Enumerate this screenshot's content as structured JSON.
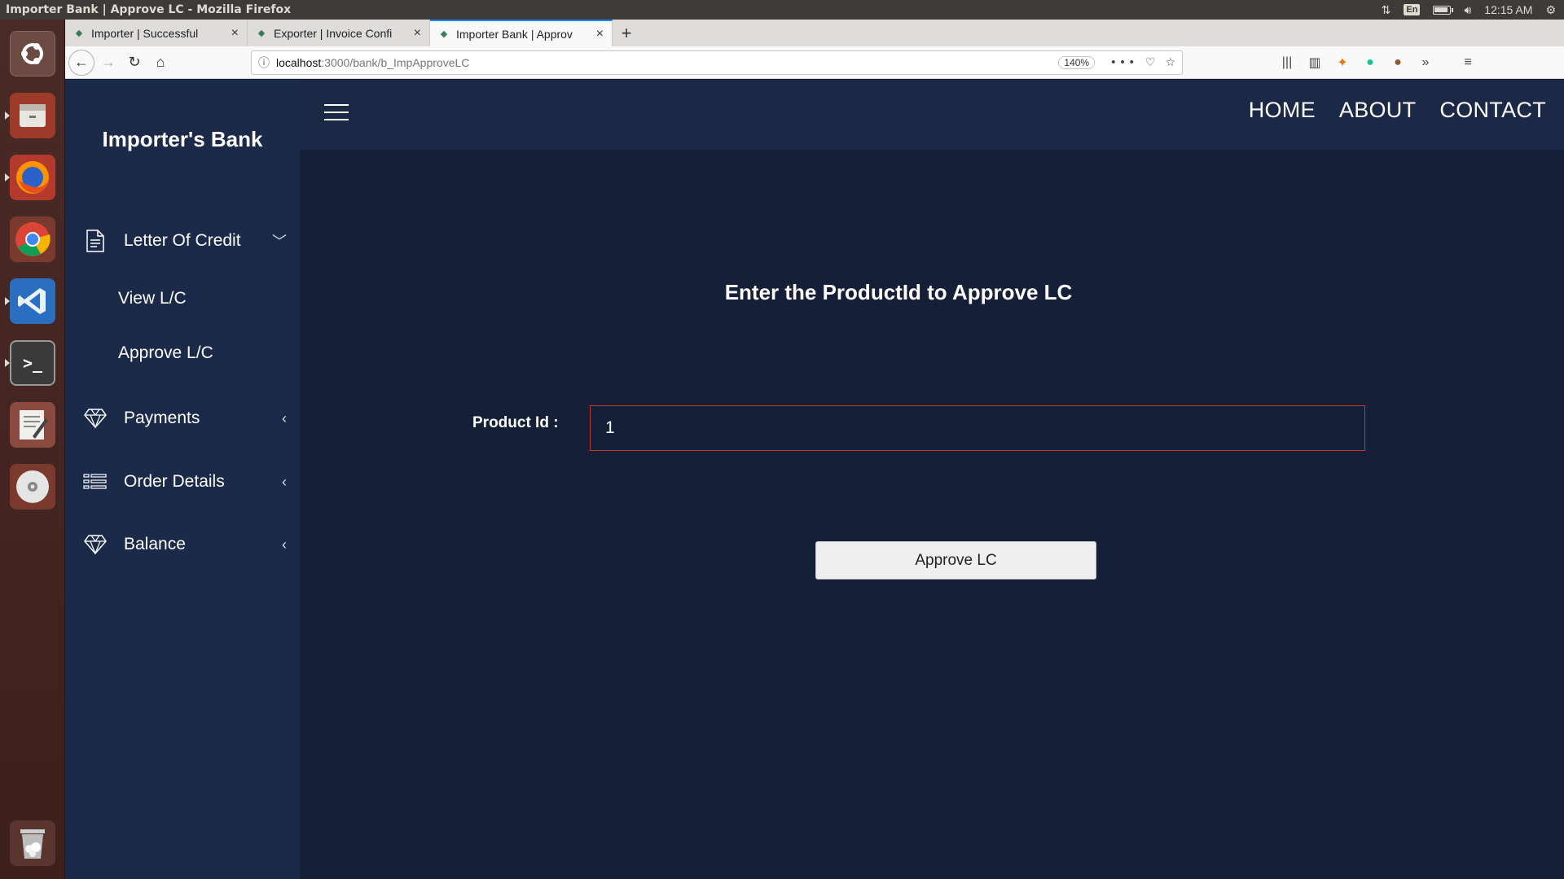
{
  "os": {
    "window_title": "Importer Bank | Approve LC - Mozilla Firefox",
    "keyboard_layout": "En",
    "clock": "12:15 AM"
  },
  "launcher": {
    "items": [
      "ubuntu-dash",
      "files",
      "firefox",
      "chrome",
      "vscode",
      "terminal",
      "text-editor",
      "disc",
      "trash"
    ]
  },
  "browser": {
    "tabs": [
      {
        "label": "Importer | Successful",
        "close": "×"
      },
      {
        "label": "Exporter | Invoice Confi",
        "close": "×"
      },
      {
        "label": "Importer Bank | Approv",
        "close": "×"
      }
    ],
    "new_tab": "+",
    "url_host": "localhost",
    "url_path": ":3000/bank/b_ImpApproveLC",
    "zoom": "140%",
    "page_actions": "•••"
  },
  "sidebar": {
    "brand": "Importer's Bank",
    "menu": [
      {
        "label": "Letter Of Credit",
        "icon": "document-icon",
        "expanded": true
      },
      {
        "label": "Payments",
        "icon": "diamond-icon",
        "expanded": false
      },
      {
        "label": "Order Details",
        "icon": "list-icon",
        "expanded": false
      },
      {
        "label": "Balance",
        "icon": "diamond-icon",
        "expanded": false
      }
    ],
    "submenu": [
      "View L/C",
      "Approve L/C"
    ]
  },
  "header": {
    "nav": [
      "HOME",
      "ABOUT",
      "CONTACT"
    ]
  },
  "form": {
    "title": "Enter the ProductId to Approve LC",
    "label": "Product Id :",
    "value": "1",
    "button": "Approve LC"
  },
  "colors": {
    "sidebar_bg": "#1c2a4a",
    "main_bg": "#161f38",
    "input_border": "#c0392b"
  }
}
